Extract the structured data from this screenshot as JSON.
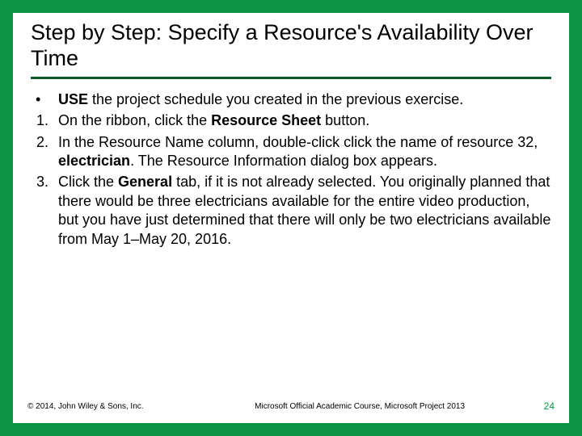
{
  "title": "Step by Step: Specify a Resource's Availability Over Time",
  "bullets": [
    {
      "marker": "•",
      "type": "dot",
      "lead_bold": "USE",
      "rest": " the project schedule you created in the previous exercise."
    },
    {
      "marker": "1.",
      "type": "num",
      "pre": "On the ribbon, click the ",
      "bold1": "Resource Sheet",
      "post1": " button."
    },
    {
      "marker": "2.",
      "type": "num",
      "pre": "In the Resource Name column, double-click click the name of resource 32, ",
      "bold1": "electrician",
      "post1": ". The Resource Information dialog box appears."
    },
    {
      "marker": "3.",
      "type": "num",
      "pre": "Click the ",
      "bold1": "General",
      "post1": " tab, if it is not already selected. You originally planned that there would be three electricians available for the entire video production, but you have just determined that there will only be two electricians available from May 1–May 20, 2016."
    }
  ],
  "footer": {
    "left": "© 2014, John Wiley & Sons, Inc.",
    "center": "Microsoft Official Academic Course, Microsoft Project 2013",
    "right": "24"
  }
}
